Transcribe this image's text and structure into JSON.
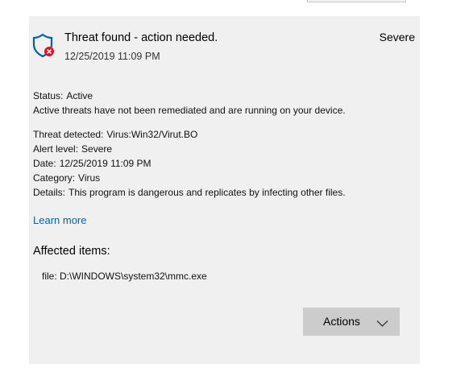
{
  "header": {
    "title": "Threat found - action needed.",
    "timestamp": "12/25/2019 11:09 PM",
    "severity": "Severe"
  },
  "status": {
    "label": "Status:",
    "value": "Active",
    "description": "Active threats have not been remediated and are running on your device."
  },
  "details": [
    {
      "label": "Threat detected:",
      "value": "Virus:Win32/Virut.BO"
    },
    {
      "label": "Alert level:",
      "value": "Severe"
    },
    {
      "label": "Date:",
      "value": "12/25/2019 11:09 PM"
    },
    {
      "label": "Category:",
      "value": "Virus"
    },
    {
      "label": "Details:",
      "value": "This program is dangerous and replicates by infecting other files."
    }
  ],
  "learn_more": "Learn more",
  "affected": {
    "heading": "Affected items:",
    "items": [
      "file: D:\\WINDOWS\\system32\\mmc.exe"
    ]
  },
  "actions_button": "Actions",
  "colors": {
    "shield": "#0063b1",
    "alert_badge": "#e81123",
    "link": "#0063b1",
    "card_bg": "#f0f0f0",
    "button_bg": "#cccccc"
  },
  "icons": {
    "shield": "shield-alert-icon",
    "chevron": "chevron-down-icon"
  }
}
